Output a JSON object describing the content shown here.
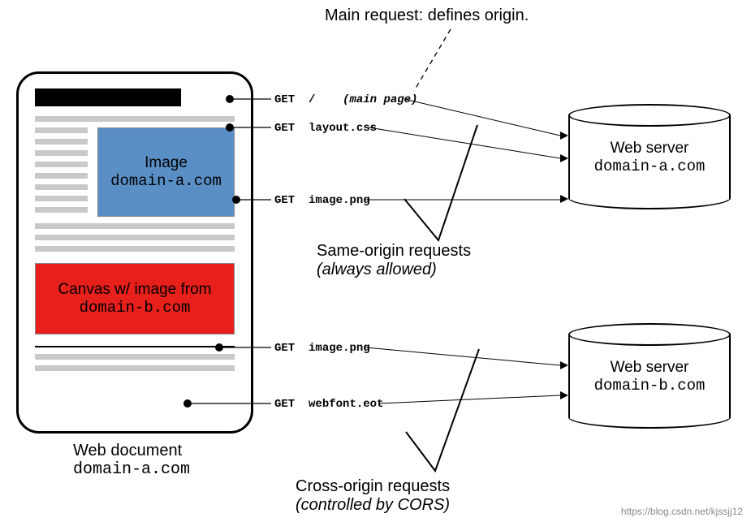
{
  "top_title": "Main request: defines origin.",
  "webdoc": {
    "image_box": {
      "line1": "Image",
      "line2": "domain-a.com"
    },
    "canvas_box": {
      "line1": "Canvas w/ image from",
      "line2": "domain-b.com"
    },
    "caption": {
      "line1": "Web document",
      "line2": "domain-a.com"
    }
  },
  "requests": {
    "r1": {
      "method": "GET",
      "path": "/",
      "note": "(main page)"
    },
    "r2": {
      "method": "GET",
      "path": "layout.css"
    },
    "r3": {
      "method": "GET",
      "path": "image.png"
    },
    "r4": {
      "method": "GET",
      "path": "image.png"
    },
    "r5": {
      "method": "GET",
      "path": "webfont.eot"
    }
  },
  "annotations": {
    "same_origin": {
      "line1": "Same-origin requests",
      "line2": "(always allowed)"
    },
    "cross_origin": {
      "line1": "Cross-origin requests",
      "line2": "(controlled by CORS)"
    }
  },
  "servers": {
    "a": {
      "title": "Web server",
      "domain": "domain-a.com"
    },
    "b": {
      "title": "Web server",
      "domain": "domain-b.com"
    }
  },
  "watermark": "https://blog.csdn.net/kjssjj12"
}
